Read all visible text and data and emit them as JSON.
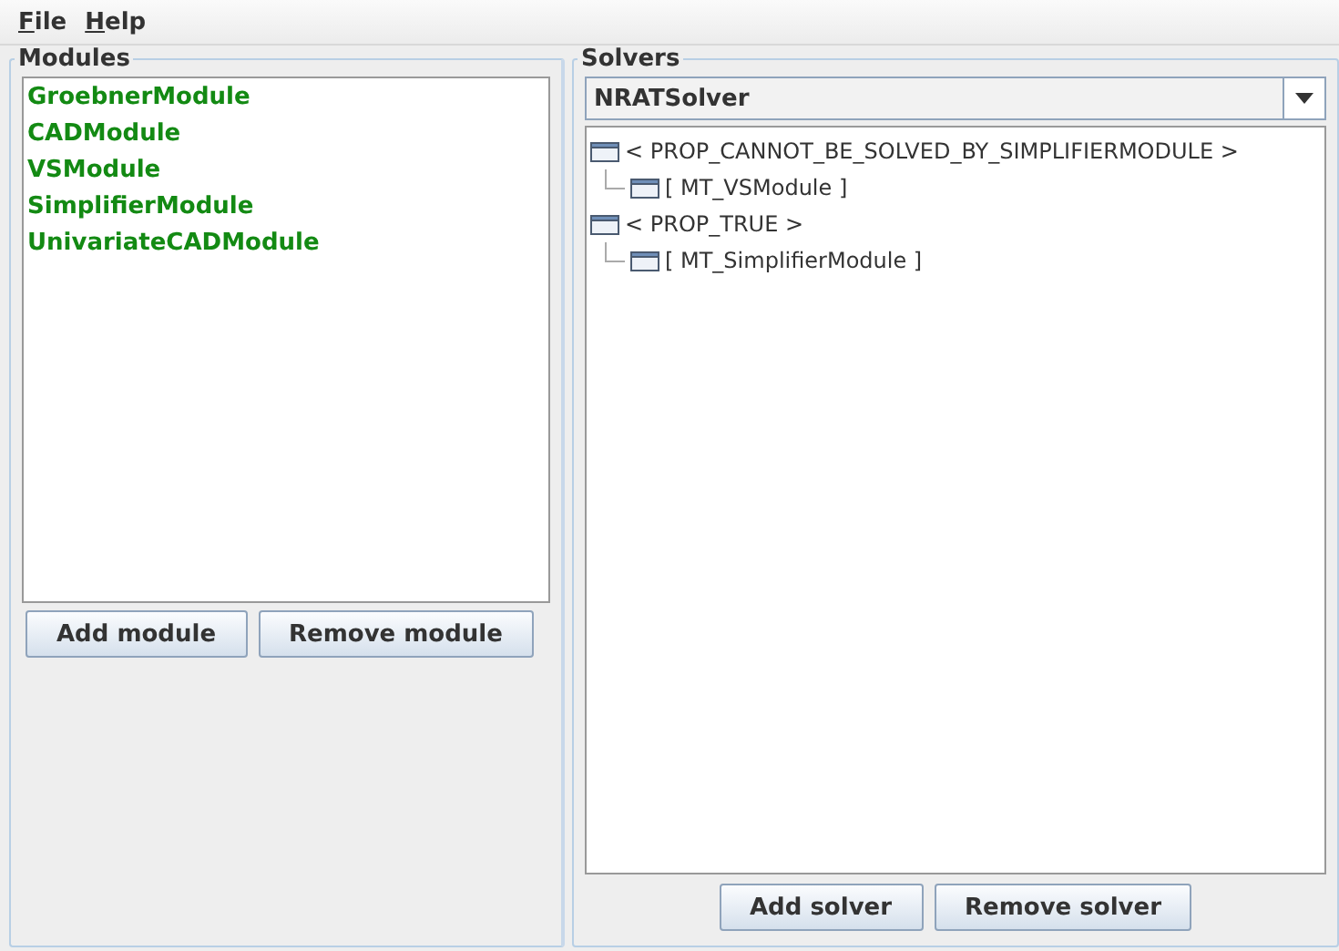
{
  "menu": [
    {
      "label": "File"
    },
    {
      "label": "Help"
    }
  ],
  "modules": {
    "title": "Modules",
    "items": [
      {
        "label": "GroebnerModule"
      },
      {
        "label": "CADModule"
      },
      {
        "label": "VSModule"
      },
      {
        "label": "SimplifierModule"
      },
      {
        "label": "UnivariateCADModule"
      }
    ],
    "buttons": [
      "Add module",
      "Remove module"
    ]
  },
  "solvers": {
    "title": "Solvers",
    "selected_solver": "NRATSolver",
    "tree": [
      {
        "label": "< PROP_CANNOT_BE_SOLVED_BY_SIMPLIFIERMODULE >",
        "children": [
          {
            "label": "[ MT_VSModule ]"
          }
        ]
      },
      {
        "label": "< PROP_TRUE >",
        "children": [
          {
            "label": "[ MT_SimplifierModule ]"
          }
        ]
      }
    ],
    "buttons": [
      "Add solver",
      "Remove solver"
    ]
  }
}
